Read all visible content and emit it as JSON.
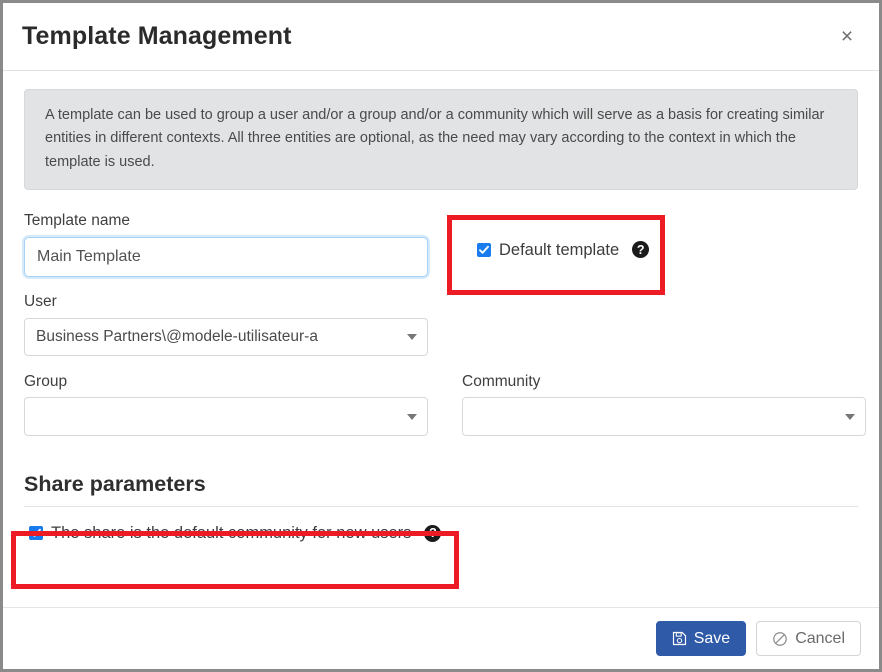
{
  "dialog": {
    "title": "Template Management",
    "close_label": "×",
    "close_icon": "close-icon"
  },
  "info": {
    "text": "A template can be used to group a user and/or a group and/or a community which will serve as a basis for creating similar entities in different contexts. All three entities are optional, as the need may vary according to the context in which the template is used."
  },
  "form": {
    "template_name": {
      "label": "Template name",
      "value": "Main Template",
      "placeholder": ""
    },
    "default_template": {
      "label": "Default template",
      "checked": true,
      "help_icon": "help-circle-icon",
      "help_glyph": "?"
    },
    "user": {
      "label": "User",
      "value": "Business Partners\\@modele-utilisateur-a",
      "placeholder": ""
    },
    "group": {
      "label": "Group",
      "value": "",
      "placeholder": ""
    },
    "community": {
      "label": "Community",
      "value": "",
      "placeholder": ""
    }
  },
  "share_section": {
    "title": "Share parameters",
    "default_community": {
      "label": "The share is the default community for new users",
      "checked": true,
      "help_icon": "help-circle-icon",
      "help_glyph": "?"
    }
  },
  "footer": {
    "save_label": "Save",
    "save_icon": "floppy-disk-icon",
    "cancel_label": "Cancel",
    "cancel_icon": "no-entry-icon"
  },
  "annotations": {
    "highlight_color": "#ed1c24",
    "boxes": [
      {
        "name": "default-template-highlight"
      },
      {
        "name": "share-default-community-highlight"
      }
    ]
  },
  "colors": {
    "primary_button": "#2f5aa8",
    "checkbox_accent": "#1a7bee",
    "info_background": "#e2e3e5",
    "focus_border": "#a7d2f5"
  }
}
